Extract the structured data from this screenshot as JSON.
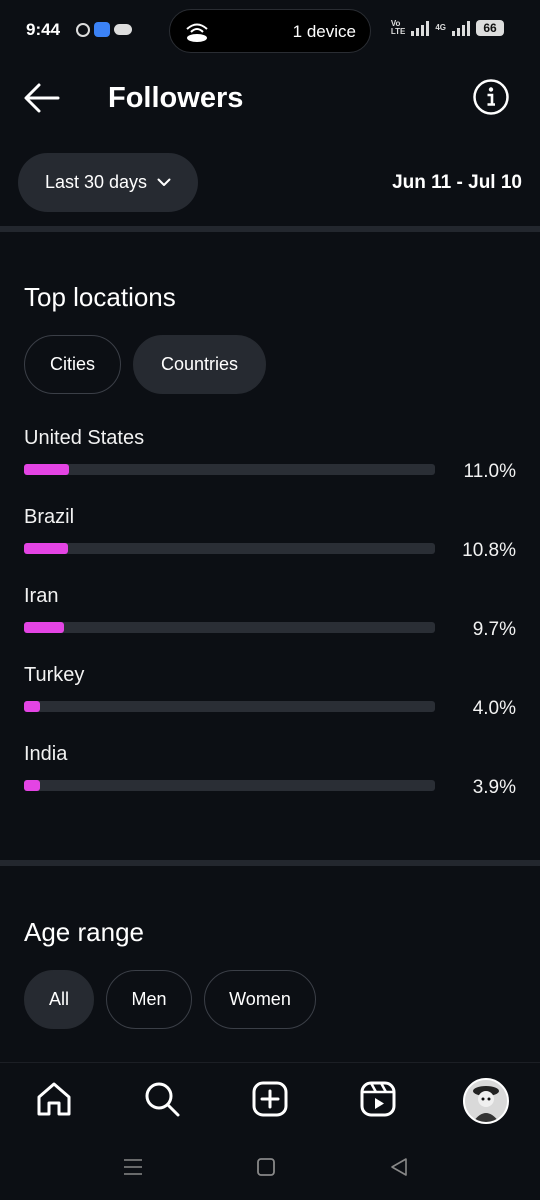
{
  "status_bar": {
    "time": "9:44",
    "island_text": "1 device",
    "network_small_top": "Vo",
    "network_small_bottom": "LTE",
    "network_4g": "4G",
    "battery": "66"
  },
  "header": {
    "title": "Followers"
  },
  "range": {
    "label": "Last 30 days",
    "dates": "Jun 11 - Jul 10"
  },
  "top_locations": {
    "title": "Top locations",
    "chips": [
      {
        "label": "Cities",
        "selected": false
      },
      {
        "label": "Countries",
        "selected": true
      }
    ],
    "items": [
      {
        "name": "United States",
        "percent_label": "11.0%",
        "percent": 11.0
      },
      {
        "name": "Brazil",
        "percent_label": "10.8%",
        "percent": 10.8
      },
      {
        "name": "Iran",
        "percent_label": "9.7%",
        "percent": 9.7
      },
      {
        "name": "Turkey",
        "percent_label": "4.0%",
        "percent": 4.0
      },
      {
        "name": "India",
        "percent_label": "3.9%",
        "percent": 3.9
      }
    ]
  },
  "age_range": {
    "title": "Age range",
    "chips": [
      {
        "label": "All",
        "selected": true
      },
      {
        "label": "Men",
        "selected": false
      },
      {
        "label": "Women",
        "selected": false
      }
    ]
  },
  "bottom_nav": {
    "icons": [
      "home-icon",
      "search-icon",
      "create-icon",
      "reels-icon",
      "profile-avatar"
    ]
  },
  "colors": {
    "accent_bar": "#e444e4",
    "background": "#0c0f14",
    "chip_fill": "#262a31"
  }
}
